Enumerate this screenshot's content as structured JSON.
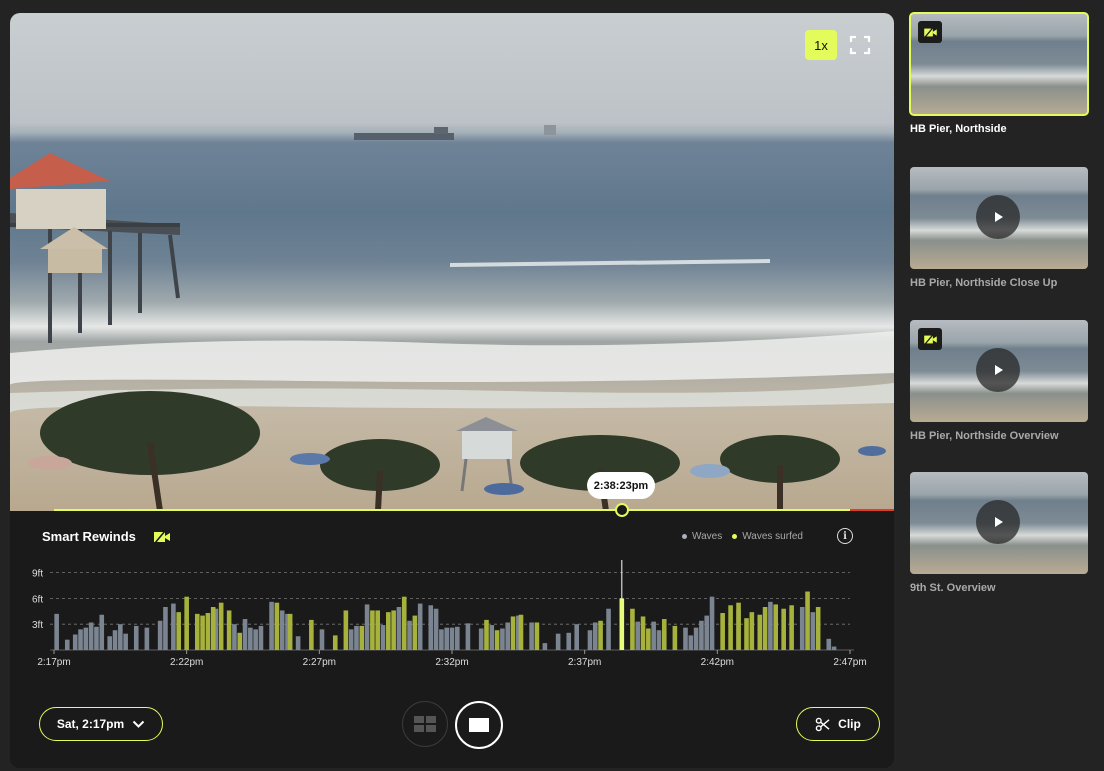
{
  "player": {
    "speed_label": "1x",
    "current_time": "2:38:23pm",
    "playback_fraction": 0.77
  },
  "smart_rewinds": {
    "title": "Smart Rewinds",
    "legend": {
      "waves": "Waves",
      "waves_surfed": "Waves surfed"
    },
    "info_label": "i"
  },
  "colors": {
    "accent": "#e4fc5b",
    "wave_bar": "#7b8591",
    "surfed_bar": "#a6b23c",
    "selected_bar": "#e8fb7a",
    "live_red": "#e23c2a"
  },
  "chart_data": {
    "type": "bar",
    "y_labels": [
      "9ft",
      "6ft",
      "3ft"
    ],
    "y_ticks_ft": [
      9,
      6,
      3
    ],
    "ylim": [
      0,
      9
    ],
    "grid": "dashed horizontal",
    "x_tick_labels": [
      "2:17pm",
      "2:22pm",
      "2:27pm",
      "2:32pm",
      "2:37pm",
      "2:42pm",
      "2:47pm"
    ],
    "x_range_min": [
      0,
      30
    ],
    "selected_time_min": 21.4,
    "series": [
      {
        "name": "Waves",
        "points": [
          [
            0.1,
            4.2
          ],
          [
            0.5,
            1.2
          ],
          [
            0.8,
            1.8
          ],
          [
            1.0,
            2.4
          ],
          [
            1.2,
            2.6
          ],
          [
            1.4,
            3.2
          ],
          [
            1.6,
            2.7
          ],
          [
            1.8,
            4.1
          ],
          [
            2.1,
            1.6
          ],
          [
            2.3,
            2.3
          ],
          [
            2.5,
            3.0
          ],
          [
            2.7,
            1.9
          ],
          [
            3.1,
            2.8
          ],
          [
            3.5,
            2.6
          ],
          [
            4.0,
            3.4
          ],
          [
            4.2,
            5.0
          ],
          [
            4.5,
            5.4
          ],
          [
            6.1,
            4.8
          ],
          [
            6.8,
            3.0
          ],
          [
            7.2,
            3.6
          ],
          [
            7.4,
            2.6
          ],
          [
            7.6,
            2.4
          ],
          [
            7.8,
            2.8
          ],
          [
            8.2,
            5.6
          ],
          [
            8.6,
            4.6
          ],
          [
            8.8,
            4.2
          ],
          [
            9.2,
            1.6
          ],
          [
            10.1,
            2.4
          ],
          [
            11.2,
            2.4
          ],
          [
            11.4,
            2.8
          ],
          [
            11.8,
            5.3
          ],
          [
            12.4,
            2.9
          ],
          [
            13.0,
            5.0
          ],
          [
            13.4,
            3.4
          ],
          [
            13.8,
            5.4
          ],
          [
            14.2,
            5.2
          ],
          [
            14.4,
            4.8
          ],
          [
            14.6,
            2.4
          ],
          [
            14.8,
            2.6
          ],
          [
            15.0,
            2.6
          ],
          [
            15.2,
            2.7
          ],
          [
            15.6,
            3.1
          ],
          [
            16.1,
            2.5
          ],
          [
            16.5,
            2.9
          ],
          [
            16.9,
            2.5
          ],
          [
            17.1,
            3.2
          ],
          [
            17.5,
            4.0
          ],
          [
            18.0,
            3.2
          ],
          [
            18.5,
            0.8
          ],
          [
            19.0,
            1.9
          ],
          [
            19.4,
            2.0
          ],
          [
            19.7,
            3.0
          ],
          [
            20.2,
            2.3
          ],
          [
            20.4,
            3.2
          ],
          [
            20.9,
            4.8
          ],
          [
            22.0,
            3.3
          ],
          [
            22.6,
            3.3
          ],
          [
            22.8,
            2.3
          ],
          [
            23.8,
            2.6
          ],
          [
            24.0,
            1.7
          ],
          [
            24.2,
            2.6
          ],
          [
            24.4,
            3.4
          ],
          [
            24.6,
            4.0
          ],
          [
            24.8,
            6.2
          ],
          [
            25.8,
            4.7
          ],
          [
            27.0,
            5.6
          ],
          [
            28.2,
            5.0
          ],
          [
            28.6,
            4.4
          ],
          [
            29.2,
            1.3
          ],
          [
            29.4,
            0.4
          ]
        ]
      },
      {
        "name": "Waves surfed",
        "points": [
          [
            4.7,
            4.4
          ],
          [
            5.0,
            6.2
          ],
          [
            5.4,
            4.2
          ],
          [
            5.6,
            4.0
          ],
          [
            5.8,
            4.3
          ],
          [
            6.0,
            5.0
          ],
          [
            6.3,
            5.5
          ],
          [
            6.6,
            4.6
          ],
          [
            7.0,
            2.0
          ],
          [
            8.4,
            5.5
          ],
          [
            8.9,
            4.2
          ],
          [
            9.7,
            3.5
          ],
          [
            10.6,
            1.7
          ],
          [
            11.0,
            4.6
          ],
          [
            11.6,
            2.8
          ],
          [
            12.0,
            4.6
          ],
          [
            12.2,
            4.6
          ],
          [
            12.6,
            4.4
          ],
          [
            12.8,
            4.6
          ],
          [
            13.2,
            6.2
          ],
          [
            13.6,
            4.0
          ],
          [
            16.3,
            3.5
          ],
          [
            16.7,
            2.3
          ],
          [
            17.3,
            3.9
          ],
          [
            17.6,
            4.1
          ],
          [
            18.2,
            3.2
          ],
          [
            20.6,
            3.4
          ],
          [
            21.4,
            6.0
          ],
          [
            21.8,
            4.8
          ],
          [
            22.2,
            3.9
          ],
          [
            22.4,
            2.5
          ],
          [
            23.0,
            3.6
          ],
          [
            23.4,
            2.8
          ],
          [
            25.2,
            4.3
          ],
          [
            25.5,
            5.2
          ],
          [
            25.8,
            5.5
          ],
          [
            26.1,
            3.7
          ],
          [
            26.3,
            4.4
          ],
          [
            26.6,
            4.1
          ],
          [
            26.8,
            5.0
          ],
          [
            27.2,
            5.3
          ],
          [
            27.5,
            4.8
          ],
          [
            27.8,
            5.2
          ],
          [
            28.4,
            6.8
          ],
          [
            28.8,
            5.0
          ]
        ]
      }
    ]
  },
  "controls": {
    "date_label": "Sat, 2:17pm",
    "clip_label": "Clip"
  },
  "cameras": [
    {
      "name": "HB Pier, Northside",
      "active": true,
      "rewind_badge": true
    },
    {
      "name": "HB Pier, Northside Close Up",
      "active": false,
      "rewind_badge": false
    },
    {
      "name": "HB Pier, Northside Overview",
      "active": false,
      "rewind_badge": true
    },
    {
      "name": "9th St. Overview",
      "active": false,
      "rewind_badge": false
    }
  ]
}
